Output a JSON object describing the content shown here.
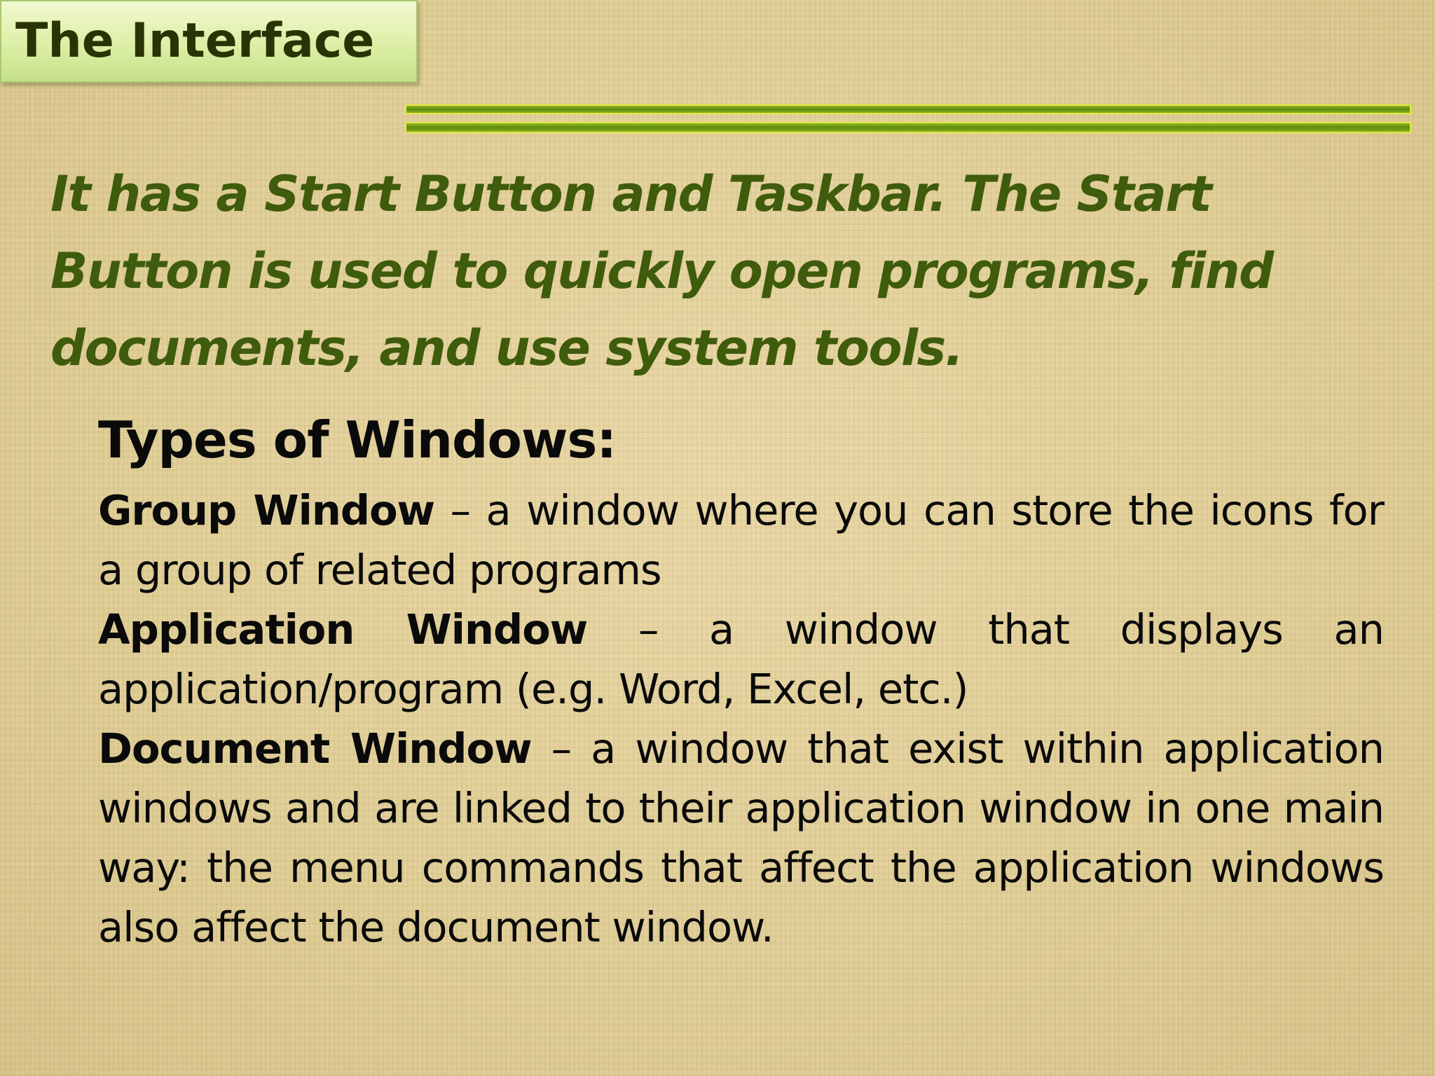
{
  "slide": {
    "title": "The Interface",
    "intro": "It has a Start Button and Taskbar.  The Start Button is used to quickly open programs, find documents, and use system tools."
  },
  "types_section": {
    "heading": "Types of Windows:",
    "items": [
      {
        "term": "Group Window",
        "description": " – a window where you can store the icons for a group of related programs"
      },
      {
        "term": "Application Window",
        "description": " – a window that displays an application/program (e.g.  Word, Excel, etc.)"
      },
      {
        "term": "Document Window",
        "description": " – a window that exist within application windows and are linked to their application window in one main way: the menu commands that affect the application windows also affect the document window."
      }
    ]
  },
  "colors": {
    "background": "#e6d6a2",
    "title_box": "#dcefa6",
    "title_text": "#2a3306",
    "accent_rule": "#5e8e0d",
    "rule_border": "#e2ea42",
    "intro_text": "#3f5b0c",
    "body_text": "#0a0a0a"
  }
}
